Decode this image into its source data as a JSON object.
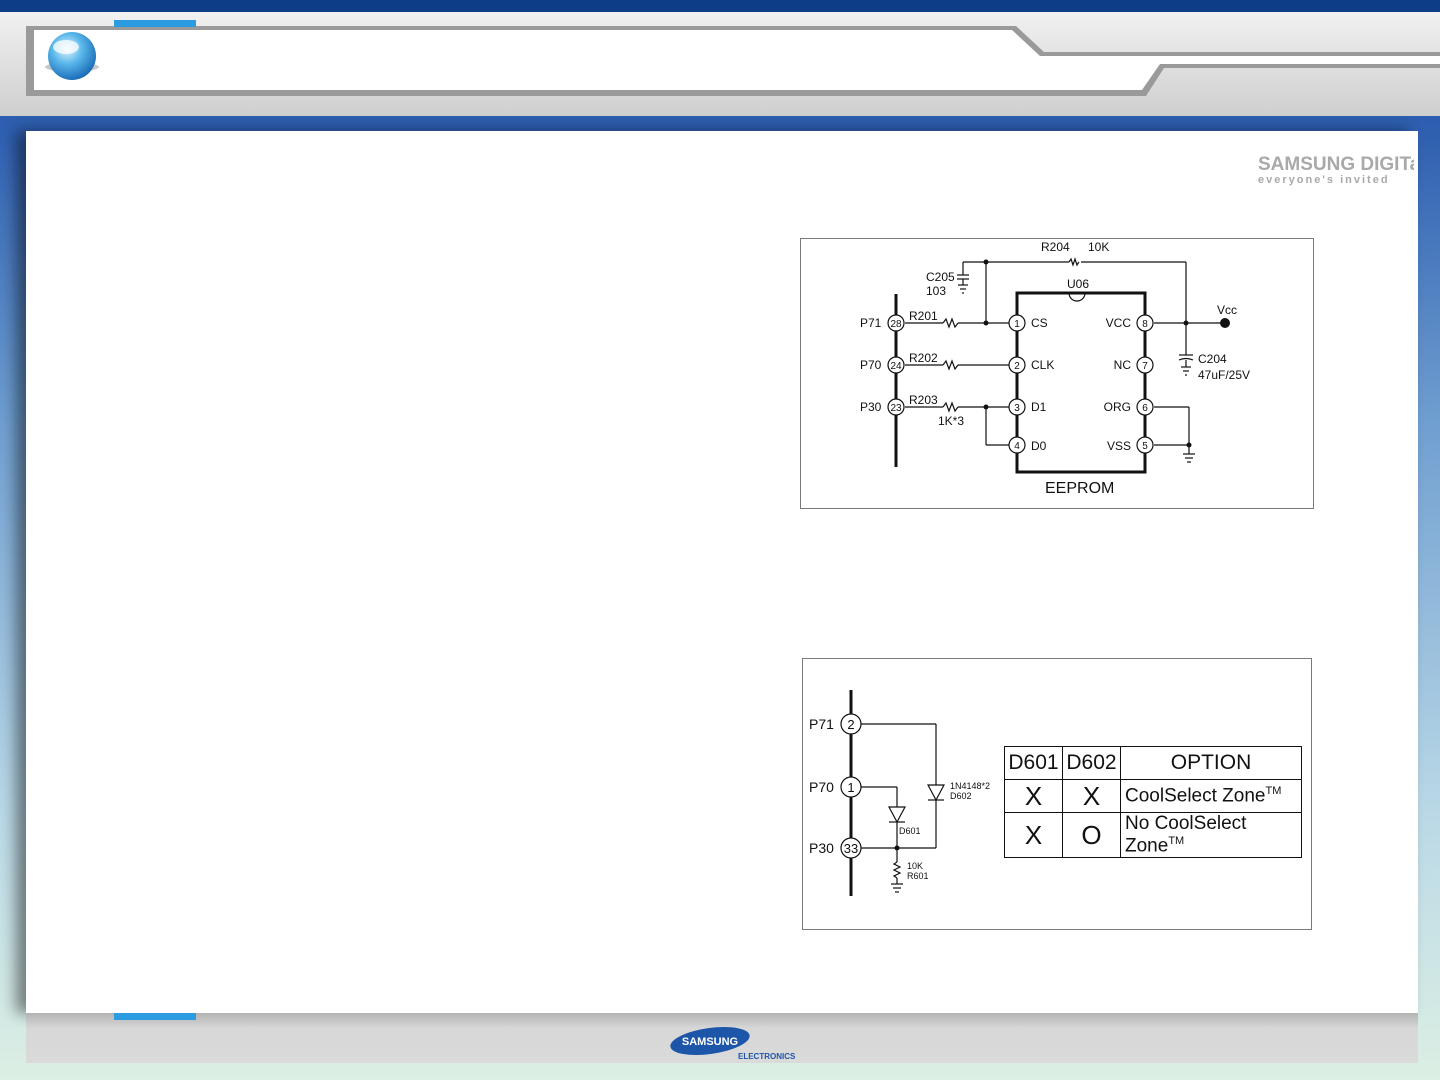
{
  "brand": {
    "logo_text": "SAMSUNG DIGITall",
    "slogan": "everyone's invited",
    "footer_logo": "SAMSUNG",
    "footer_sub": "ELECTRONICS"
  },
  "eeprom_diagram": {
    "chip_ref": "U06",
    "chip_label": "EEPROM",
    "mcu_ports": [
      {
        "port": "P71",
        "pin": "28",
        "resistor": "R201"
      },
      {
        "port": "P70",
        "pin": "24",
        "resistor": "R202"
      },
      {
        "port": "P30",
        "pin": "23",
        "resistor": "R203"
      }
    ],
    "resistor_value": "1K*3",
    "chip_pins_left": [
      {
        "num": "1",
        "name": "CS"
      },
      {
        "num": "2",
        "name": "CLK"
      },
      {
        "num": "3",
        "name": "D1"
      },
      {
        "num": "4",
        "name": "D0"
      }
    ],
    "chip_pins_right": [
      {
        "num": "8",
        "name": "VCC"
      },
      {
        "num": "7",
        "name": "NC"
      },
      {
        "num": "6",
        "name": "ORG"
      },
      {
        "num": "5",
        "name": "VSS"
      }
    ],
    "c205": {
      "ref": "C205",
      "value": "103"
    },
    "r204": {
      "ref": "R204",
      "value": "10K"
    },
    "c204": {
      "ref": "C204",
      "value": "47uF/25V"
    },
    "vcc_label": "Vcc"
  },
  "option_diagram": {
    "ports": [
      {
        "port": "P71",
        "pin": "2"
      },
      {
        "port": "P70",
        "pin": "1"
      },
      {
        "port": "P30",
        "pin": "33"
      }
    ],
    "diode_part": "1N4148*2",
    "d602": "D602",
    "d601": "D601",
    "r601": {
      "value": "10K",
      "ref": "R601"
    },
    "table": {
      "headers": [
        "D601",
        "D602",
        "OPTION"
      ],
      "rows": [
        {
          "d601": "X",
          "d602": "X",
          "option": "CoolSelect Zone",
          "tm": "TM"
        },
        {
          "d601": "X",
          "d602": "O",
          "option": "No CoolSelect Zone",
          "tm": "TM"
        }
      ]
    }
  }
}
